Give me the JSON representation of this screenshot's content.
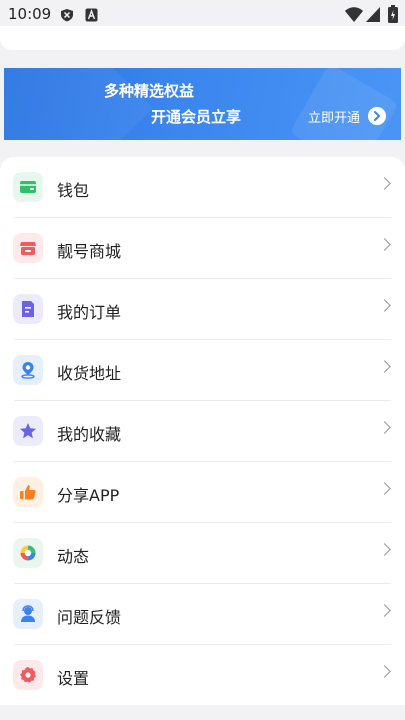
{
  "status": {
    "time": "10:09"
  },
  "banner": {
    "line1": "多种精选权益",
    "line2": "开通会员立享",
    "cta": "立即开通"
  },
  "menu": [
    {
      "label": "钱包",
      "icon": "wallet-icon",
      "bg": "#e7f7ee",
      "color": "#2fbf6b"
    },
    {
      "label": "靓号商城",
      "icon": "store-icon",
      "bg": "#fde9ea",
      "color": "#ef5b61"
    },
    {
      "label": "我的订单",
      "icon": "order-icon",
      "bg": "#ecebfb",
      "color": "#6a63e6"
    },
    {
      "label": "收货地址",
      "icon": "address-icon",
      "bg": "#e6effd",
      "color": "#3c82ea"
    },
    {
      "label": "我的收藏",
      "icon": "favorite-icon",
      "bg": "#ecebfb",
      "color": "#6a63e6"
    },
    {
      "label": "分享APP",
      "icon": "share-thumb-icon",
      "bg": "#fff0e3",
      "color": "#ff7f1f"
    },
    {
      "label": "动态",
      "icon": "moments-icon",
      "bg": "#eaf6ef",
      "color": "#3bbd7a"
    },
    {
      "label": "问题反馈",
      "icon": "feedback-icon",
      "bg": "#e6effd",
      "color": "#3c82ea"
    },
    {
      "label": "设置",
      "icon": "settings-icon",
      "bg": "#fde9ea",
      "color": "#ef5b61"
    }
  ]
}
